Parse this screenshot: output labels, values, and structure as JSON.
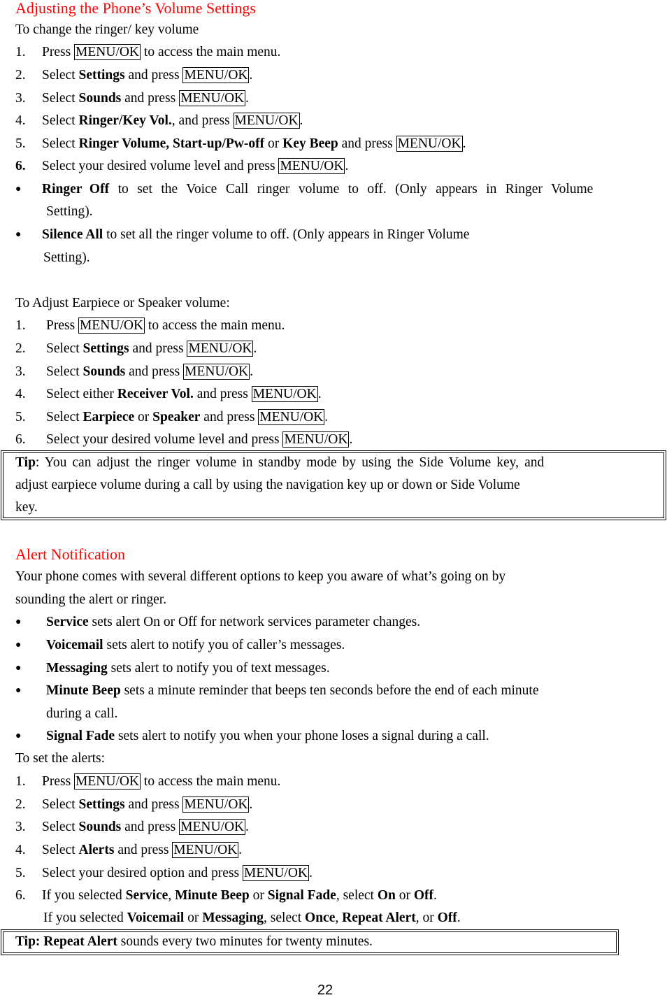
{
  "section1": {
    "title": "Adjusting the Phone’s Volume Settings",
    "intro": "To change the ringer/ key volume",
    "steps": [
      {
        "num": "1.",
        "pre": "Press ",
        "key": "MENU/OK",
        "post": " to access the main menu."
      },
      {
        "num": "2.",
        "pre": "Select ",
        "bold": "Settings",
        "mid": " and press ",
        "key": "MENU/OK",
        "post": "."
      },
      {
        "num": "3.",
        "pre": "Select ",
        "bold": "Sounds",
        "mid": " and press ",
        "key": "MENU/OK",
        "post": "."
      },
      {
        "num": "4.",
        "pre": "Select ",
        "bold": "Ringer/Key Vol.",
        "mid": ", and press ",
        "key": "MENU/OK",
        "post": "."
      },
      {
        "num": "5.",
        "pre": "Select ",
        "bold": "Ringer Volume, Start-up/Pw-off",
        "mid": " or ",
        "bold2": "Key Beep",
        "mid2": " and press ",
        "key": "MENU/OK",
        "post": "."
      },
      {
        "num": "6.",
        "pre": "Select your desired volume level and press ",
        "key": "MENU/OK",
        "post": "."
      }
    ],
    "bullets": [
      {
        "bold": "Ringer Off",
        "text1": " to set the Voice Call ringer volume to off. (Only appears in Ringer Volume",
        "text2": "Setting)."
      },
      {
        "bold": "Silence All",
        "text1": " to set all the ringer volume to off. (Only appears in Ringer Volume",
        "text2": "Setting)."
      }
    ],
    "intro2": "To Adjust Earpiece or Speaker volume:",
    "steps2": [
      {
        "num": "1.",
        "pre": "Press ",
        "key": "MENU/OK",
        "post": " to access the main menu."
      },
      {
        "num": "2.",
        "pre": "Select ",
        "bold": "Settings",
        "mid": " and press ",
        "key": "MENU/OK",
        "post": "."
      },
      {
        "num": "3.",
        "pre": "Select ",
        "bold": "Sounds",
        "mid": " and press ",
        "key": "MENU/OK",
        "post": "."
      },
      {
        "num": "4.",
        "pre": "Select either ",
        "bold": "Receiver Vol.",
        "mid": " and press ",
        "key": "MENU/OK",
        "post": "."
      },
      {
        "num": "5.",
        "pre": "Select ",
        "bold": "Earpiece",
        "mid": " or ",
        "bold2": "Speaker",
        "mid2": " and press ",
        "key": "MENU/OK",
        "post": "."
      },
      {
        "num": "6.",
        "pre": "Select your desired volume level and press ",
        "key": "MENU/OK",
        "post": "."
      }
    ],
    "tip": {
      "label": "Tip",
      "line1": ": You can adjust the ringer volume in standby mode by using the Side Volume key, and",
      "line2": "adjust earpiece volume during a call by using the navigation key up or down or Side Volume",
      "line3": "key."
    }
  },
  "section2": {
    "title": "Alert Notification",
    "intro1": "Your phone comes with several different options to keep you aware of what’s going on by",
    "intro2": "sounding the alert or ringer.",
    "bullets": [
      {
        "bold": "Service",
        "text": " sets alert On or Off for network services parameter changes."
      },
      {
        "bold": "Voicemail",
        "text": " sets alert to notify you of caller’s messages."
      },
      {
        "bold": "Messaging",
        "text": " sets alert to notify you of text messages."
      },
      {
        "bold": "Minute Beep",
        "text": " sets a minute reminder that beeps ten seconds before the end of each minute",
        "text2": "during a call."
      },
      {
        "bold": "Signal Fade",
        "text": " sets alert to notify you when your phone loses a signal during a call."
      }
    ],
    "intro3": "To set the alerts:",
    "steps": [
      {
        "num": "1.",
        "pre": "Press ",
        "key": "MENU/OK",
        "post": " to access the main menu."
      },
      {
        "num": "2.",
        "pre": "Select ",
        "bold": "Settings",
        "mid": " and press ",
        "key": "MENU/OK",
        "post": "."
      },
      {
        "num": "3.",
        "pre": "Select ",
        "bold": "Sounds",
        "mid": " and press ",
        "key": "MENU/OK",
        "post": "."
      },
      {
        "num": "4.",
        "pre": "Select ",
        "bold": "Alerts",
        "mid": " and press ",
        "key": "MENU/OK",
        "post": "."
      },
      {
        "num": "5.",
        "pre": "Select your desired option and press ",
        "key": "MENU/OK",
        "post": "."
      }
    ],
    "step6": {
      "num": "6.",
      "a": "If you selected ",
      "b1": "Service",
      ", ": "",
      "c": ", ",
      "b2": "Minute Beep",
      "d": " or ",
      "b3": "Signal Fade",
      "e": ", select ",
      "b4": "On",
      "f": " or ",
      "b5": "Off",
      "g": ".",
      "a2": "If you selected ",
      "c1": "Voicemail",
      "c2": " or ",
      "c3": "Messaging",
      "c4": ", select ",
      "c5": "Once",
      "c6": ", ",
      "c7": "Repeat Alert",
      "c8": ", or ",
      "c9": "Off",
      "c10": "."
    },
    "tip": {
      "label": "Tip: ",
      "bold": "Repeat Alert",
      "text": " sounds every two minutes for twenty minutes."
    }
  },
  "page_number": "22"
}
